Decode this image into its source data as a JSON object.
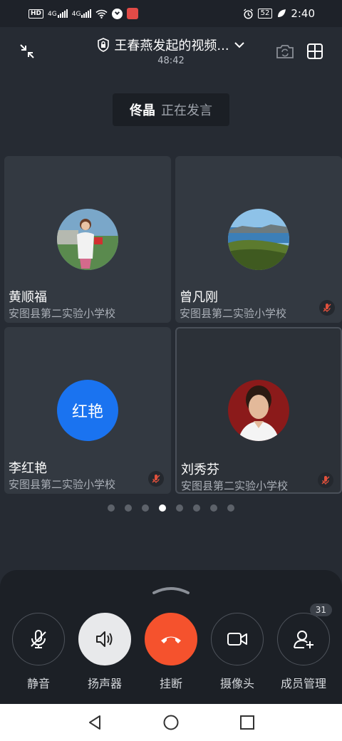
{
  "status_bar": {
    "hd": "HD",
    "net1": "4G",
    "net2": "4G",
    "battery": "52",
    "time": "2:40"
  },
  "header": {
    "title": "王春燕发起的视频...",
    "timer": "48:42",
    "icons": [
      "minimize-icon",
      "shield-lock-icon",
      "chevron-down-icon",
      "camera-switch-icon",
      "grid-layout-icon"
    ]
  },
  "speaking": {
    "name": "佟晶",
    "status": "正在发言"
  },
  "participants": [
    {
      "name": "黄顺福",
      "org": "安图县第二实验小学校",
      "avatar_type": "photo",
      "muted": false
    },
    {
      "name": "曾凡刚",
      "org": "安图县第二实验小学校",
      "avatar_type": "landscape",
      "muted": true
    },
    {
      "name": "李红艳",
      "org": "安图县第二实验小学校",
      "avatar_type": "text",
      "avatar_text": "红艳",
      "avatar_color": "#1a73f0",
      "muted": true
    },
    {
      "name": "刘秀芬",
      "org": "安图县第二实验小学校",
      "avatar_type": "photo",
      "muted": true
    }
  ],
  "pagination": {
    "total": 8,
    "current": 4
  },
  "controls": [
    {
      "label": "静音",
      "icon": "mic-off-icon"
    },
    {
      "label": "扬声器",
      "icon": "speaker-icon"
    },
    {
      "label": "挂断",
      "icon": "hangup-icon"
    },
    {
      "label": "摄像头",
      "icon": "camera-icon"
    },
    {
      "label": "成员管理",
      "icon": "add-member-icon",
      "badge": "31"
    }
  ],
  "colors": {
    "background": "#262b33",
    "hangup": "#f5522d",
    "accent_blue": "#1a73f0",
    "mute_red": "#e0503c"
  }
}
